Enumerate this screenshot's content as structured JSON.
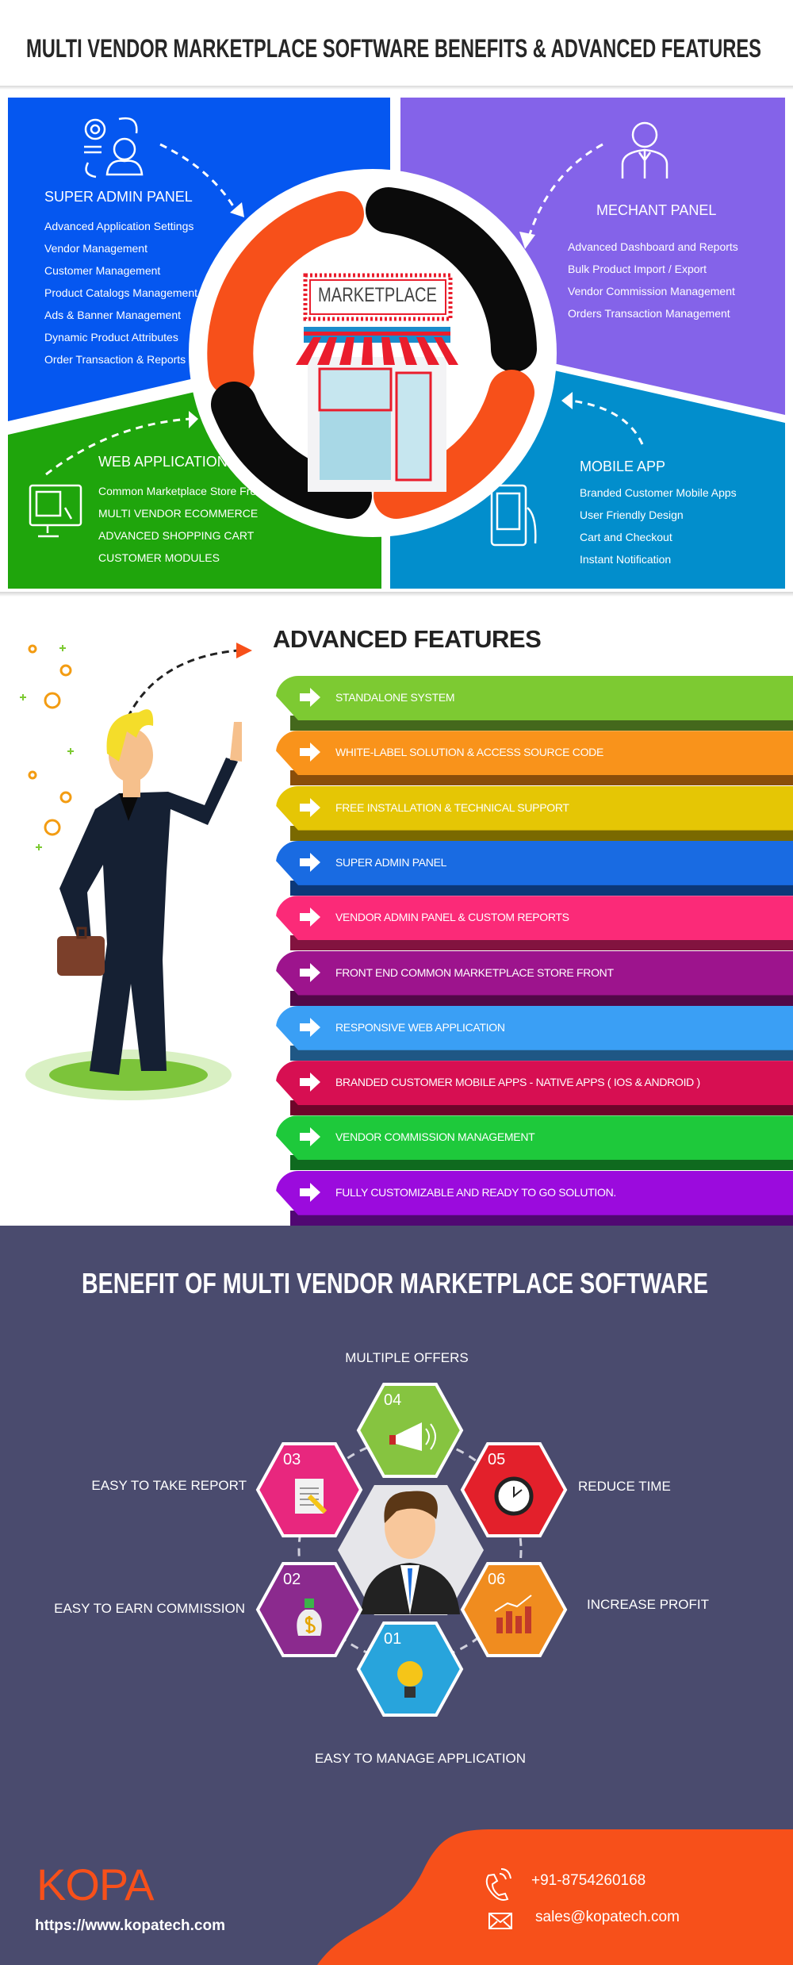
{
  "title": "MULTI VENDOR MARKETPLACE SOFTWARE BENEFITS & ADVANCED FEATURES",
  "overview": {
    "center_sign": "MARKETPLACE",
    "panels": {
      "super_admin": {
        "title": "SUPER ADMIN PANEL",
        "icon": "admin-settings-icon",
        "color": "#0557f0",
        "items": [
          "Advanced Application Settings",
          "Vendor Management",
          "Customer Management",
          "Product Catalogs Management",
          "Ads & Banner Management",
          "Dynamic Product Attributes",
          "Order Transaction & Reports"
        ]
      },
      "merchant": {
        "title": "MECHANT PANEL",
        "icon": "merchant-user-icon",
        "color": "#8463e9",
        "items": [
          "Advanced Dashboard and Reports",
          "Bulk Product Import / Export",
          "Vendor Commission Management",
          "Orders Transaction Management"
        ]
      },
      "web_app": {
        "title": "WEB APPLICATION",
        "icon": "desktop-monitor-icon",
        "color": "#1fa50c",
        "items": [
          "Common Marketplace Store Front",
          "MULTI VENDOR ECOMMERCE",
          "ADVANCED SHOPPING CART",
          "CUSTOMER MODULES"
        ]
      },
      "mobile_app": {
        "title": "MOBILE APP",
        "icon": "mobile-phone-icon",
        "color": "#028ecc",
        "items": [
          "Branded Customer Mobile Apps",
          "User Friendly Design",
          "Cart and Checkout",
          "Instant Notification"
        ]
      }
    }
  },
  "advanced_features": {
    "heading": "ADVANCED FEATURES",
    "items": [
      {
        "label": "STANDALONE SYSTEM",
        "color": "#7dca32",
        "shade": "#44681c"
      },
      {
        "label": "WHITE-LABEL SOLUTION & ACCESS SOURCE CODE",
        "color": "#f9931b",
        "shade": "#8a4e0a"
      },
      {
        "label": "FREE INSTALLATION & TECHNICAL SUPPORT",
        "color": "#e5c605",
        "shade": "#7a6900"
      },
      {
        "label": "SUPER ADMIN PANEL",
        "color": "#196be2",
        "shade": "#0c3878"
      },
      {
        "label": "VENDOR ADMIN PANEL & CUSTOM REPORTS",
        "color": "#fb2a78",
        "shade": "#82133f"
      },
      {
        "label": "FRONT END COMMON MARKETPLACE STORE FRONT",
        "color": "#9d148d",
        "shade": "#520848"
      },
      {
        "label": "RESPONSIVE WEB APPLICATION",
        "color": "#3a9ff5",
        "shade": "#1f5785"
      },
      {
        "label": "BRANDED CUSTOMER MOBILE APPS - NATIVE APPS ( IOS & ANDROID )",
        "color": "#d70f52",
        "shade": "#6e052a"
      },
      {
        "label": "VENDOR COMMISSION MANAGEMENT",
        "color": "#1ec93b",
        "shade": "#0f6a1f"
      },
      {
        "label": "FULLY CUSTOMIZABLE AND READY TO GO SOLUTION.",
        "color": "#9b0bdd",
        "shade": "#500872"
      }
    ]
  },
  "benefits": {
    "heading": "BENEFIT OF MULTI VENDOR MARKETPLACE SOFTWARE",
    "items": [
      {
        "num": "01",
        "label": "EASY TO MANAGE APPLICATION",
        "icon": "lightbulb-icon",
        "color": "#28a4dc"
      },
      {
        "num": "02",
        "label": "EASY TO EARN COMMISSION",
        "icon": "money-bag-icon",
        "color": "#8b2a8e"
      },
      {
        "num": "03",
        "label": "EASY TO TAKE REPORT",
        "icon": "report-document-icon",
        "color": "#e8277e"
      },
      {
        "num": "04",
        "label": "MULTIPLE OFFERS",
        "icon": "megaphone-icon",
        "color": "#86c440"
      },
      {
        "num": "05",
        "label": "REDUCE TIME",
        "icon": "clock-icon",
        "color": "#e3202b"
      },
      {
        "num": "06",
        "label": "INCREASE PROFIT",
        "icon": "bar-chart-icon",
        "color": "#f08c1f"
      }
    ]
  },
  "footer": {
    "logo": "KOPA",
    "url": "https://www.kopatech.com",
    "phone": "+91-8754260168",
    "email": "sales@kopatech.com",
    "accent": "#f7501a"
  }
}
